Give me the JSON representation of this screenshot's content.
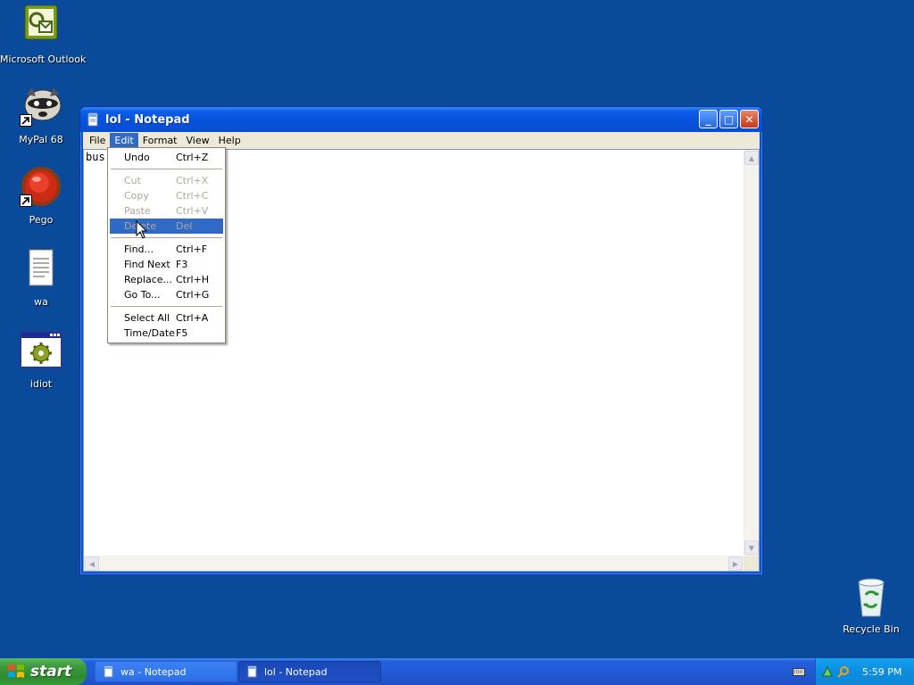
{
  "desktop": {
    "icons": [
      {
        "label": "Microsoft Outlook"
      },
      {
        "label": "MyPal 68"
      },
      {
        "label": "Pego"
      },
      {
        "label": "wa"
      },
      {
        "label": "idiot"
      },
      {
        "label": "Recycle Bin"
      }
    ]
  },
  "window": {
    "title": "lol - Notepad",
    "buttons": {
      "minimize": "_",
      "maximize": "□",
      "close": "✕"
    },
    "menu": [
      "File",
      "Edit",
      "Format",
      "View",
      "Help"
    ],
    "content": "bus"
  },
  "edit_menu": {
    "items": [
      {
        "label": "Undo",
        "shortcut": "Ctrl+Z",
        "enabled": true
      },
      {
        "label": "Cut",
        "shortcut": "Ctrl+X",
        "enabled": false
      },
      {
        "label": "Copy",
        "shortcut": "Ctrl+C",
        "enabled": false
      },
      {
        "label": "Paste",
        "shortcut": "Ctrl+V",
        "enabled": false
      },
      {
        "label": "Delete",
        "shortcut": "Del",
        "enabled": false
      },
      {
        "label": "Find...",
        "shortcut": "Ctrl+F",
        "enabled": true
      },
      {
        "label": "Find Next",
        "shortcut": "F3",
        "enabled": true
      },
      {
        "label": "Replace...",
        "shortcut": "Ctrl+H",
        "enabled": true
      },
      {
        "label": "Go To...",
        "shortcut": "Ctrl+G",
        "enabled": true
      },
      {
        "label": "Select All",
        "shortcut": "Ctrl+A",
        "enabled": true
      },
      {
        "label": "Time/Date",
        "shortcut": "F5",
        "enabled": true
      }
    ]
  },
  "taskbar": {
    "start_label": "start",
    "tasks": [
      {
        "label": "wa - Notepad",
        "active": false
      },
      {
        "label": "lol - Notepad",
        "active": true
      }
    ],
    "clock": "5:59 PM"
  },
  "colors": {
    "desktop": "#0a4a9a",
    "titlebar": "#0a5ce6",
    "menu_highlight": "#316ac5",
    "disabled_text": "#aca899"
  }
}
